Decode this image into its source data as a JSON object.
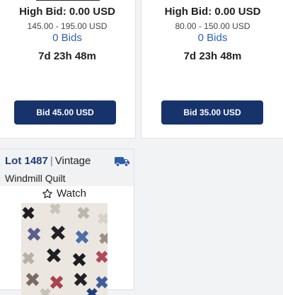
{
  "cards": [
    {
      "high_bid": "High Bid: 0.00 USD",
      "range": "145.00 - 195.00 USD",
      "bids": "0 Bids",
      "timer": "7d 23h 48m",
      "button": "Bid 45.00 USD"
    },
    {
      "high_bid": "High Bid: 0.00 USD",
      "range": "80.00 - 150.00 USD",
      "bids": "0 Bids",
      "timer": "7d 23h 48m",
      "button": "Bid 35.00 USD"
    }
  ],
  "lot": {
    "number": "Lot 1487",
    "separator": "|",
    "name_line1": "Vintage",
    "name_line2": "Windmill Quilt",
    "watch": "Watch",
    "shipping_icon": "truck-icon",
    "watch_icon": "star-outline-icon"
  },
  "colors": {
    "button_bg": "#17336b",
    "bids_link": "#2d63b3",
    "lot_number": "#1f3f7a",
    "truck": "#2d5ea8"
  }
}
